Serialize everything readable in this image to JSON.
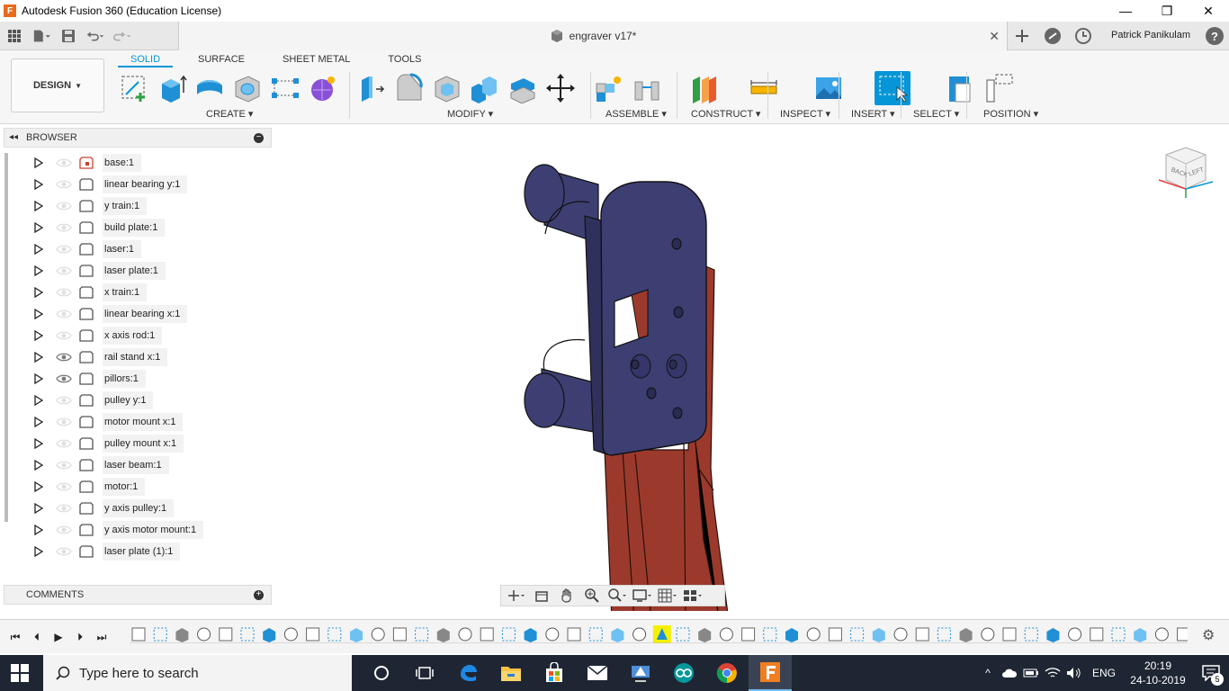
{
  "window": {
    "title": "Autodesk Fusion 360 (Education License)",
    "app_logo_letter": "F"
  },
  "document": {
    "title": "engraver v17*"
  },
  "user": {
    "name": "Patrick Panikulam",
    "help_symbol": "?"
  },
  "ribbon": {
    "workspace": "DESIGN",
    "tabs": [
      {
        "label": "SOLID",
        "active": true
      },
      {
        "label": "SURFACE",
        "active": false
      },
      {
        "label": "SHEET METAL",
        "active": false
      },
      {
        "label": "TOOLS",
        "active": false
      }
    ],
    "groups": [
      "CREATE",
      "MODIFY",
      "ASSEMBLE",
      "CONSTRUCT",
      "INSPECT",
      "INSERT",
      "SELECT",
      "POSITION"
    ]
  },
  "browser": {
    "title": "BROWSER",
    "items": [
      {
        "label": "base:1",
        "visible": false
      },
      {
        "label": "linear bearing y:1",
        "visible": false
      },
      {
        "label": "y train:1",
        "visible": false
      },
      {
        "label": "build plate:1",
        "visible": false
      },
      {
        "label": "laser:1",
        "visible": false
      },
      {
        "label": "laser plate:1",
        "visible": false
      },
      {
        "label": "x train:1",
        "visible": false
      },
      {
        "label": "linear bearing x:1",
        "visible": false
      },
      {
        "label": "x axis rod:1",
        "visible": false
      },
      {
        "label": "rail stand x:1",
        "visible": true
      },
      {
        "label": "pillors:1",
        "visible": true
      },
      {
        "label": "pulley y:1",
        "visible": false
      },
      {
        "label": "motor mount x:1",
        "visible": false
      },
      {
        "label": "pulley mount x:1",
        "visible": false
      },
      {
        "label": "laser beam:1",
        "visible": false
      },
      {
        "label": "motor:1",
        "visible": false
      },
      {
        "label": "y axis pulley:1",
        "visible": false
      },
      {
        "label": "y axis motor mount:1",
        "visible": false
      },
      {
        "label": "laser plate (1):1",
        "visible": false
      }
    ]
  },
  "comments": {
    "title": "COMMENTS"
  },
  "viewcube": {
    "face_back": "BACK",
    "face_left": "LEFT"
  },
  "taskbar": {
    "search_placeholder": "Type here to search",
    "language": "ENG",
    "time": "20:19",
    "date": "24-10-2019",
    "notification_count": "5"
  },
  "colors": {
    "accent": "#0696d7",
    "model_blue": "#3d3f73",
    "model_red": "#9b3a2c",
    "taskbar": "#1f2633"
  }
}
